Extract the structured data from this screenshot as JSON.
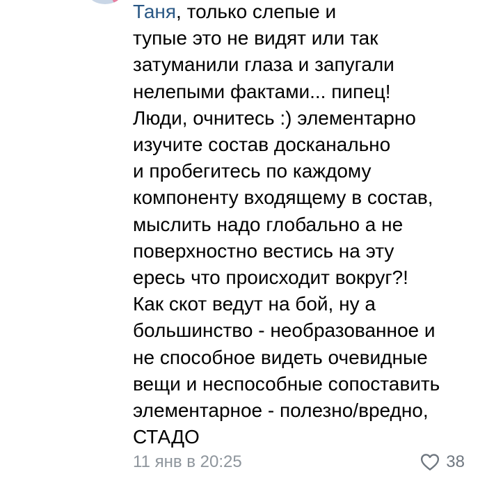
{
  "comment": {
    "mention": "Таня",
    "first_line_rest": ", только слепые и",
    "lines": [
      "тупые это не видят или так",
      "затуманили глаза и запугали",
      "нелепыми фактами... пипец!",
      "Люди, очнитесь :) элементарно",
      "изучите состав досканально",
      "и пробегитесь по каждому",
      "компоненту входящему в состав,",
      "мыслить надо глобально а не",
      "поверхностно вестись на эту",
      "ересь что происходит вокруг?!",
      "Как скот ведут на бой, ну а",
      "большинство - необразованное и",
      "не способное видеть очевидные",
      "вещи и неспособные сопоставить",
      "элементарное - полезно/вредно,",
      "СТАДО"
    ]
  },
  "footer": {
    "timestamp": "11 янв в 20:25",
    "like_icon": "heart-icon",
    "like_count": "38"
  },
  "colors": {
    "text": "#000000",
    "mention": "#2a5885",
    "meta": "#8e959c",
    "icon": "#6f7780"
  }
}
